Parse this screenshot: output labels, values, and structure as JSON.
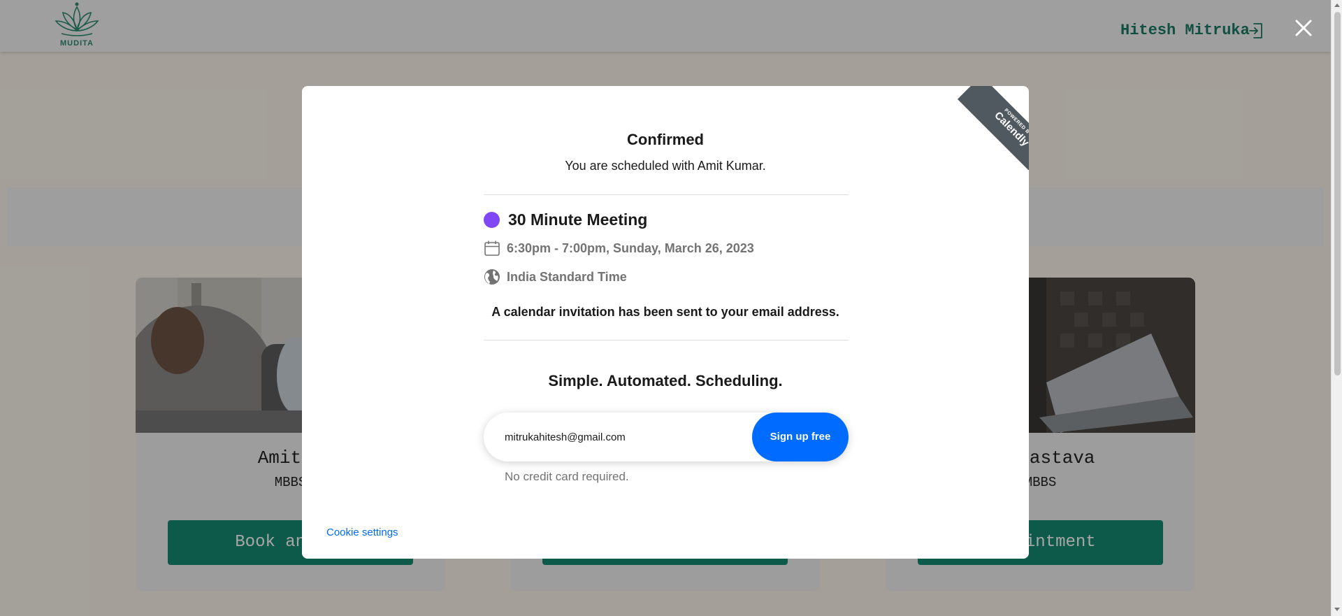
{
  "header": {
    "logo_text": "MUDITA",
    "user_name": "Hitesh Mitruka",
    "logout_icon": "logout-icon",
    "close_icon": "close-icon"
  },
  "cards": [
    {
      "name": "Amit K",
      "degree": "MBBS",
      "button_label": "Book an App"
    },
    {
      "name": "",
      "degree": "",
      "button_label": ""
    },
    {
      "name": "Srivastava",
      "degree": "MBBS",
      "button_label": "Appointment"
    }
  ],
  "modal": {
    "ribbon_small": "POWERED BY",
    "ribbon_brand": "Calendly",
    "title": "Confirmed",
    "subtitle": "You are scheduled with Amit Kumar.",
    "event_name": "30 Minute Meeting",
    "event_color": "#8247f5",
    "event_time": "6:30pm - 7:00pm, Sunday, March 26, 2023",
    "timezone": "India Standard Time",
    "invite_note": "A calendar invitation has been sent to your email address.",
    "tagline": "Simple. Automated. Scheduling.",
    "email_value": "mitrukahitesh@gmail.com",
    "signup_label": "Sign up free",
    "no_credit_card": "No credit card required.",
    "cookie_settings": "Cookie settings"
  },
  "colors": {
    "brand_green": "#168a72",
    "calendly_blue": "#006bff"
  }
}
